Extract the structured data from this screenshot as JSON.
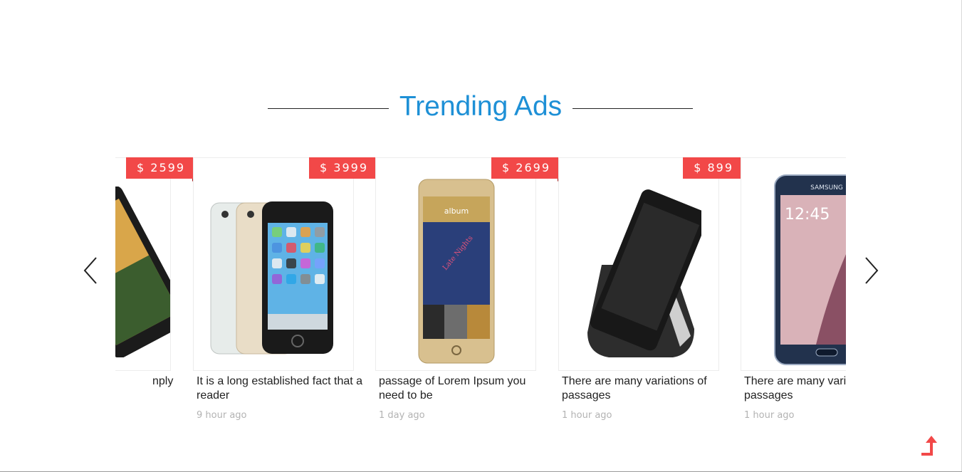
{
  "section": {
    "title": "Trending Ads"
  },
  "ads": [
    {
      "price": "$ 2599",
      "title": "nply",
      "time": ""
    },
    {
      "price": "$ 3999",
      "title": "It is a long established fact that a reader",
      "time": "9 hour ago"
    },
    {
      "price": "$ 2699",
      "title": "passage of Lorem Ipsum you need to be",
      "time": "1 day ago"
    },
    {
      "price": "$ 899",
      "title": "There are many variations of passages",
      "time": "1 hour ago"
    },
    {
      "price": "",
      "title": "There are many variations of passages",
      "time": "1 hour ago"
    }
  ],
  "phone_screen": {
    "album_label": "album",
    "album_art_text": "Late Nights",
    "clock": "12:45",
    "brand": "SAMSUNG"
  },
  "colors": {
    "accent": "#1e90d6",
    "badge": "#f24848",
    "muted_text": "#b3b3b3"
  },
  "icons": {
    "prev": "chevron-left-icon",
    "next": "chevron-right-icon",
    "back_to_top": "arrow-up-icon"
  }
}
